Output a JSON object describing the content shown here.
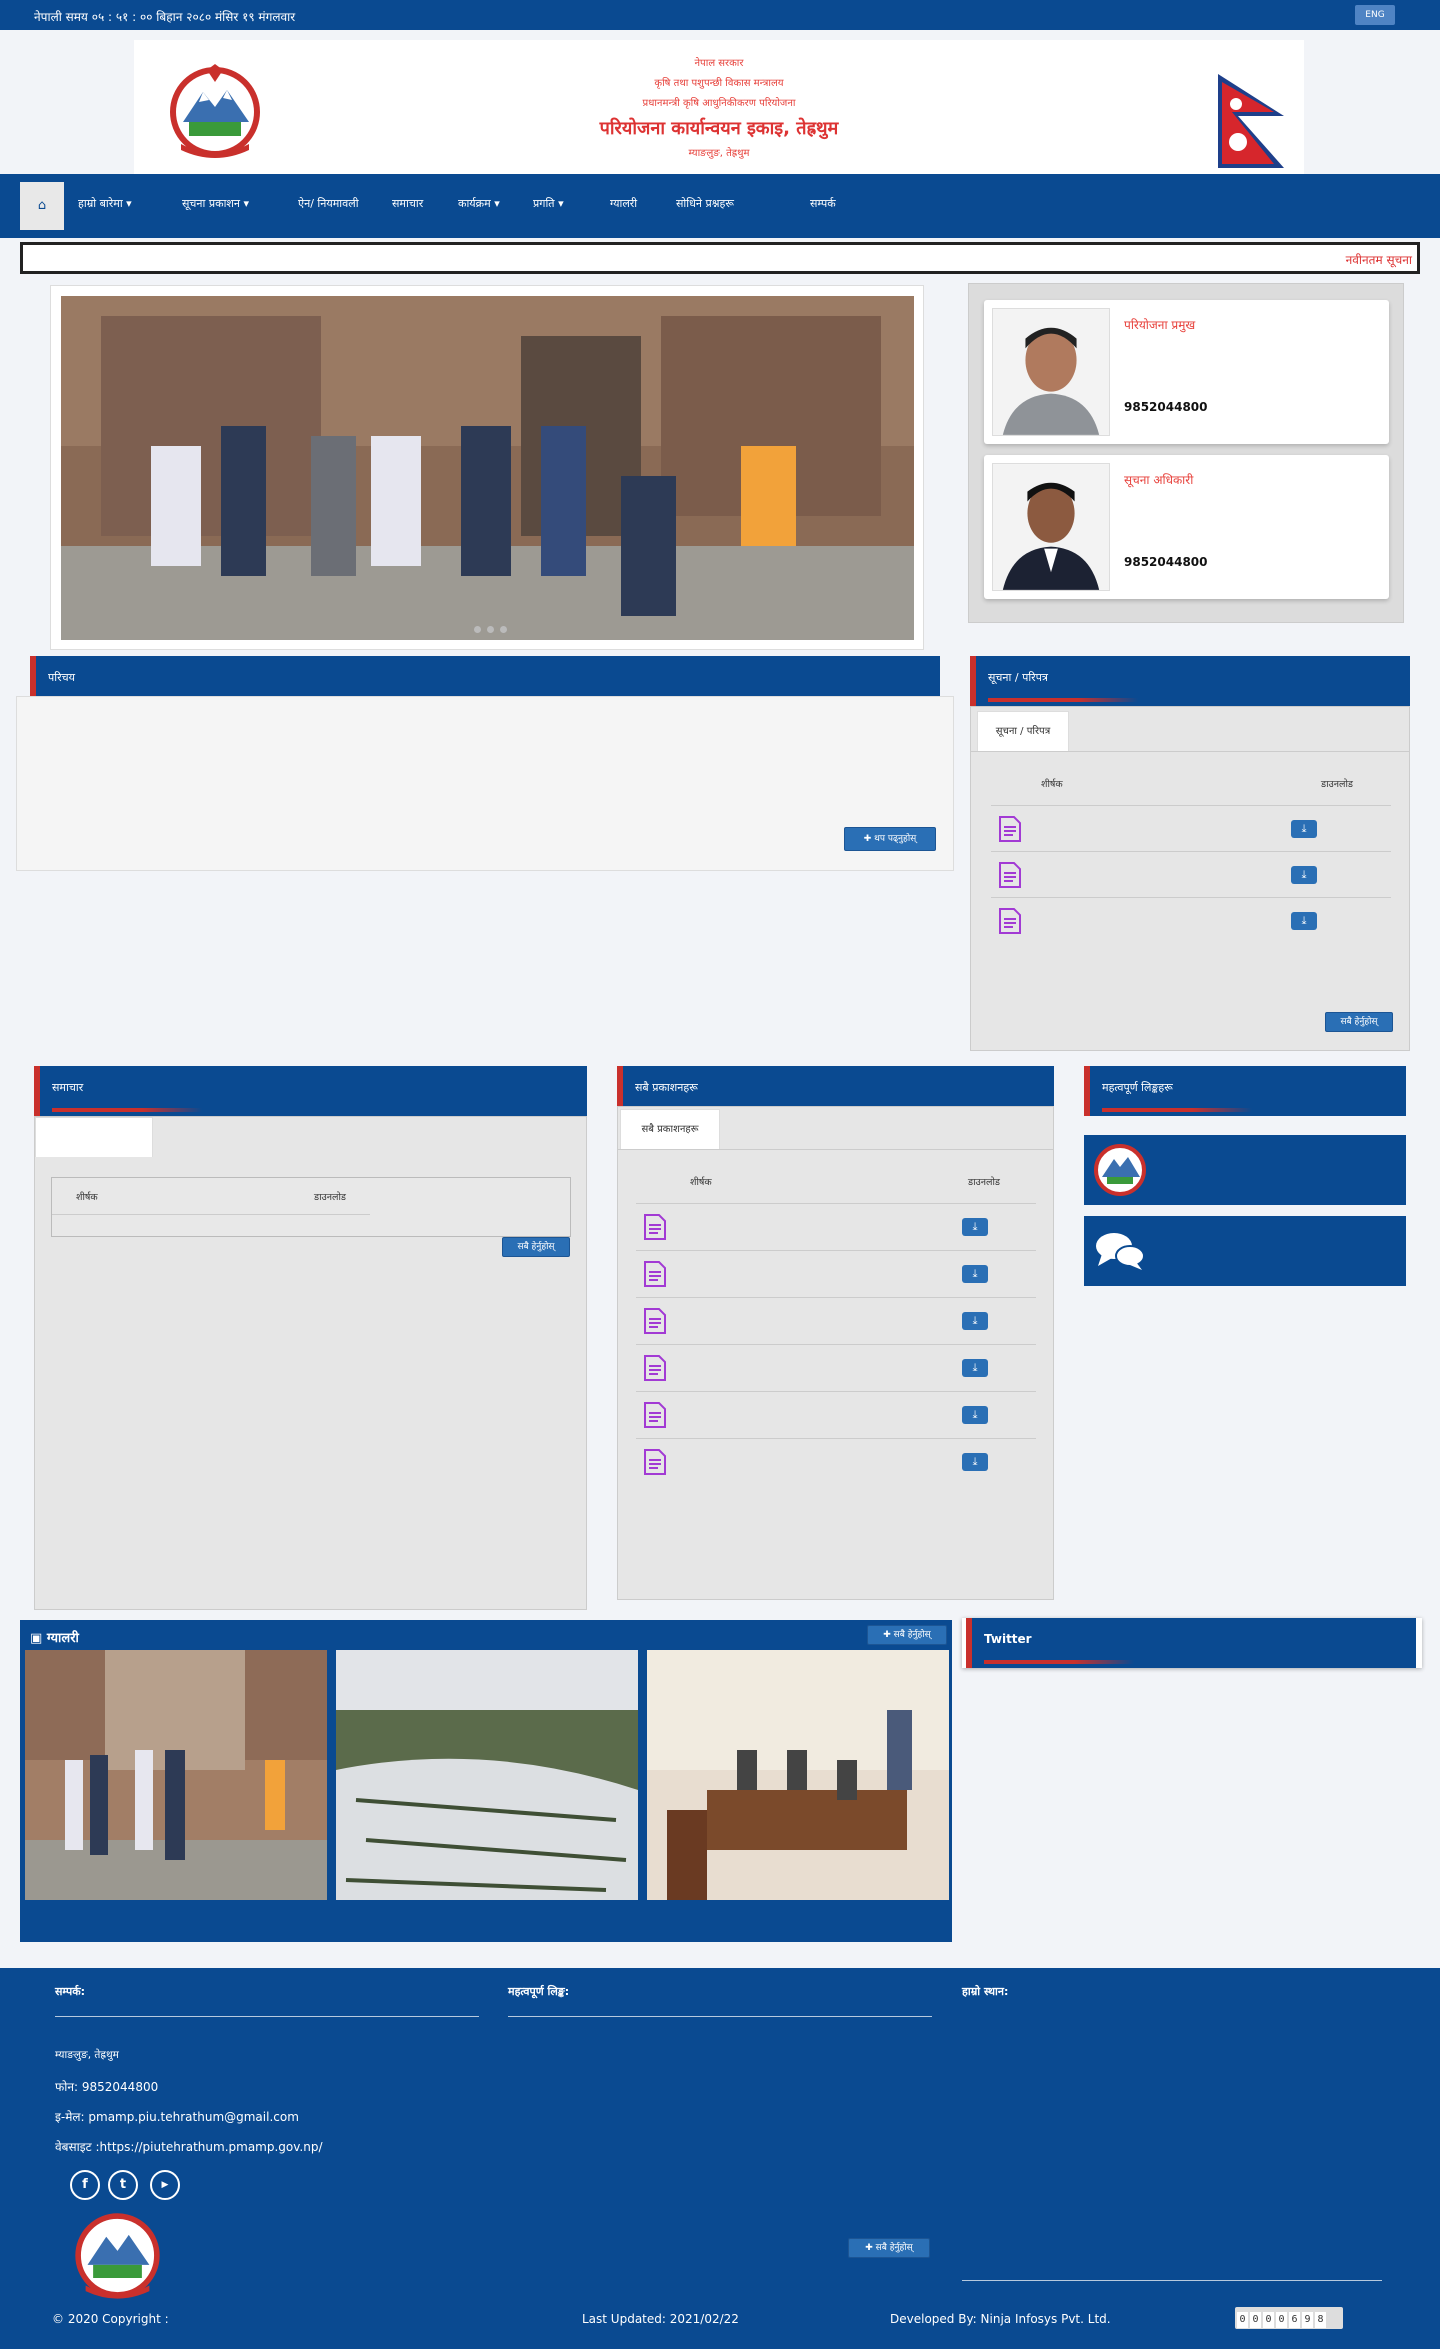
{
  "topbar": {
    "nepali_time": "नेपाली समय ०५ : ५१ : ०० बिहान    २०८० मंसिर १९ मंगलवार",
    "lang_button": "ENG"
  },
  "header": {
    "line1": "नेपाल सरकार",
    "line2": "कृषि तथा पशुपन्छी विकास मन्त्रालय",
    "line3": "प्रधानमन्त्री कृषि आधुनिकीकरण परियोजना",
    "title": "परियोजना कार्यान्वयन इकाइ, तेह्रथुम",
    "address": "म्याङलुङ, तेह्रथुम"
  },
  "nav": {
    "home_icon": "home-icon",
    "items": [
      {
        "label": "हाम्रो बारेमा",
        "dropdown": true
      },
      {
        "label": "सूचना प्रकाशन",
        "dropdown": true
      },
      {
        "label": "ऐन/ नियमावली",
        "dropdown": false
      },
      {
        "label": "समाचार",
        "dropdown": false
      },
      {
        "label": "कार्यक्रम",
        "dropdown": true
      },
      {
        "label": "प्रगति",
        "dropdown": true
      },
      {
        "label": "ग्यालरी",
        "dropdown": false
      },
      {
        "label": "सोधिने प्रश्नहरू",
        "dropdown": false
      },
      {
        "label": "सम्पर्क",
        "dropdown": false
      }
    ]
  },
  "marquee": {
    "text": "नवीनतम सूचना"
  },
  "profiles": [
    {
      "role": "परियोजना प्रमुख",
      "name": "",
      "designation": "",
      "phone": "9852044800"
    },
    {
      "role": "सूचना अधिकारी",
      "name": "",
      "designation": "",
      "phone": "9852044800"
    }
  ],
  "about": {
    "heading": "परिचय",
    "text": "",
    "more_button": "थप पढ्नुहोस्"
  },
  "notice": {
    "heading": "सूचना / परिपत्र",
    "tab": "सूचना / परिपत्र",
    "col_title": "शीर्षक",
    "col_download": "डाउनलोड",
    "rows": [
      "",
      "",
      ""
    ],
    "all_button": "सबै हेर्नुहोस्"
  },
  "news": {
    "heading": "समाचार",
    "tabs": [
      "",
      "",
      "",
      ""
    ],
    "col_title": "शीर्षक",
    "col_download": "डाउनलोड",
    "all_button": "सबै हेर्नुहोस्"
  },
  "publications": {
    "heading": "सबै प्रकाशनहरू",
    "tab": "सबै प्रकाशनहरू",
    "col_title": "शीर्षक",
    "col_download": "डाउनलोड",
    "rows": [
      "",
      "",
      "",
      "",
      "",
      ""
    ]
  },
  "links": {
    "heading": "महत्वपूर्ण लिङ्कहरू",
    "items": [
      {
        "label": "",
        "icon": "emblem-icon"
      },
      {
        "label": "",
        "icon": "chat-icon"
      }
    ]
  },
  "gallery": {
    "heading": "ग्यालरी",
    "all_button": "सबै हेर्नुहोस्",
    "captions": [
      "",
      "",
      ""
    ]
  },
  "twitter": {
    "heading": "Twitter"
  },
  "footer": {
    "contact_heading": "सम्पर्क:",
    "office": "",
    "address": "म्याङलुङ, तेह्रथुम",
    "phone": "फोन: 9852044800",
    "email": "इ-मेल: pmamp.piu.tehrathum@gmail.com",
    "website": "वेबसाइट :https://piutehrathum.pmamp.gov.np/",
    "links_heading": "महत्वपूर्ण लिङ्क:",
    "links": [
      "",
      "",
      "",
      "",
      "",
      "",
      ""
    ],
    "links_button": "सबै हेर्नुहोस्",
    "map_heading": "हाम्रो स्थान:",
    "copyright": "© 2020 Copyright : ",
    "updated": "Last Updated: 2021/02/22",
    "developer": "Developed By: Ninja Infosys Pvt. Ltd.",
    "counter": [
      "0",
      "0",
      "0",
      "0",
      "6",
      "9",
      "8"
    ]
  },
  "colors": {
    "primary": "#0a4a91",
    "accent": "#e7413b",
    "button": "#2a6fb5"
  }
}
